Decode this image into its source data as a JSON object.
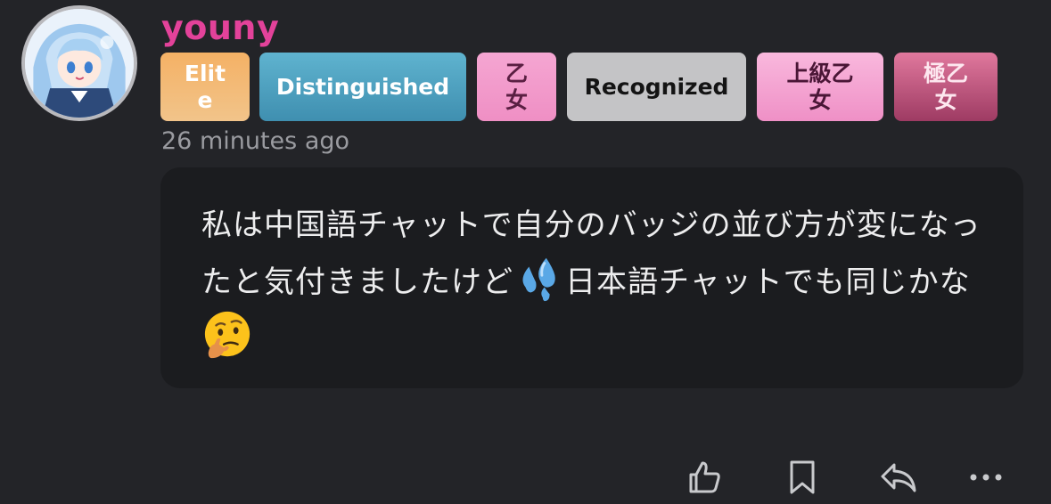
{
  "post": {
    "username": "youny",
    "username_color": "#e3429a",
    "timestamp": "26 minutes ago",
    "badges": [
      {
        "label": "Elite",
        "color": "#f4b165"
      },
      {
        "label": "Distinguished",
        "color": "#4fa3c2"
      },
      {
        "label": "乙女",
        "color": "#f29cc9"
      },
      {
        "label": "Recognized",
        "color": "#c4c4c6"
      },
      {
        "label": "上級乙女",
        "color": "#f4a6d2"
      },
      {
        "label": "極乙女",
        "color": "#b94f78"
      }
    ],
    "message": {
      "part1": "私は中国語チャットで自分のバッジの並び方が変になったと気付きましたけど",
      "emoji1": "sweat-droplets-emoji",
      "part2": "日本語チャットでも同じかな",
      "emoji2": "thinking-face-emoji"
    }
  },
  "actions": {
    "like": "thumbs-up-icon",
    "bookmark": "bookmark-icon",
    "reply": "reply-icon",
    "more": "more-icon"
  }
}
